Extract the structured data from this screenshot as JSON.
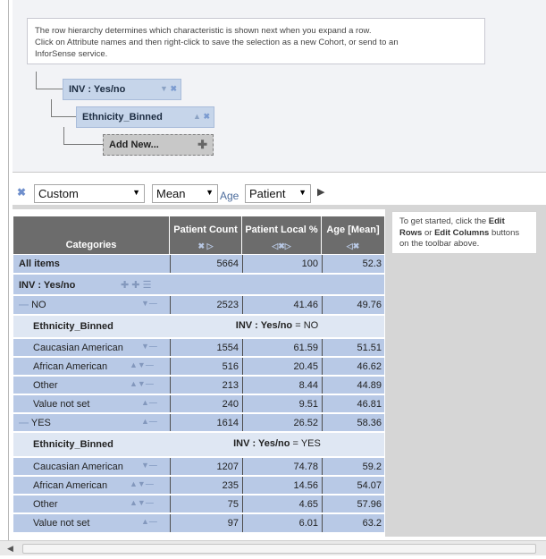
{
  "info_text": [
    "The row hierarchy determines which characteristic is shown next when you expand a row.",
    "Click on Attribute names and then right-click to save the selection as a new Cohort, or send to an",
    "InforSense service."
  ],
  "hierarchy": {
    "nodes": [
      {
        "label": "INV : Yes/no"
      },
      {
        "label": "Ethnicity_Binned"
      }
    ],
    "add_new_label": "Add New..."
  },
  "toolbar": {
    "selects": [
      "Custom",
      "Mean",
      "Patient"
    ],
    "age_label": "Age"
  },
  "table": {
    "headers": [
      "Categories",
      "Patient Count",
      "Patient Local %",
      "Age [Mean]"
    ],
    "all_items": {
      "label": "All items",
      "count": "5664",
      "pct": "100",
      "age": "52.3"
    },
    "group_label": "INV : Yes/no",
    "sections": [
      {
        "label": "NO",
        "count": "2523",
        "pct": "41.46",
        "age": "49.76",
        "sub_header": "Ethnicity_Binned",
        "filter_attr": "INV : Yes/no",
        "filter_val": " = NO",
        "rows": [
          {
            "label": "Caucasian American",
            "count": "1554",
            "pct": "61.59",
            "age": "51.51"
          },
          {
            "label": "African American",
            "count": "516",
            "pct": "20.45",
            "age": "46.62"
          },
          {
            "label": "Other",
            "count": "213",
            "pct": "8.44",
            "age": "44.89"
          },
          {
            "label": "Value not set",
            "count": "240",
            "pct": "9.51",
            "age": "46.81"
          }
        ]
      },
      {
        "label": "YES",
        "count": "1614",
        "pct": "26.52",
        "age": "58.36",
        "sub_header": "Ethnicity_Binned",
        "filter_attr": "INV : Yes/no",
        "filter_val": " = YES",
        "rows": [
          {
            "label": "Caucasian American",
            "count": "1207",
            "pct": "74.78",
            "age": "59.2"
          },
          {
            "label": "African American",
            "count": "235",
            "pct": "14.56",
            "age": "54.07"
          },
          {
            "label": "Other",
            "count": "75",
            "pct": "4.65",
            "age": "57.96"
          },
          {
            "label": "Value not set",
            "count": "97",
            "pct": "6.01",
            "age": "63.2"
          }
        ]
      }
    ]
  },
  "hint": {
    "pre": "To get started, click the ",
    "edit_rows": "Edit Rows",
    "mid": " or ",
    "edit_cols": "Edit Columns",
    "post": " buttons on the toolbar above."
  }
}
